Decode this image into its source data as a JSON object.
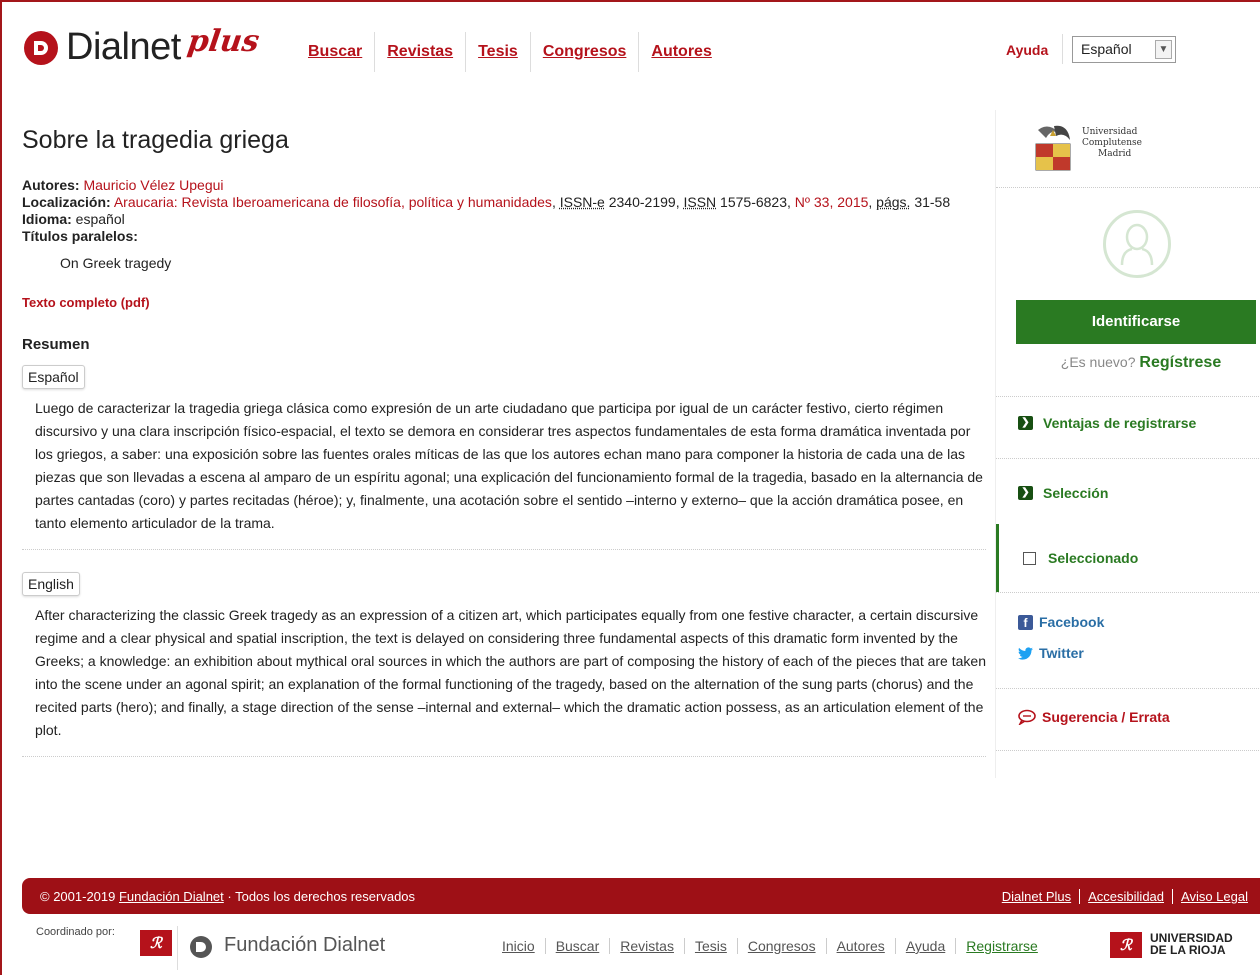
{
  "header": {
    "logo_text": "Dialnet",
    "logo_plus": "plus",
    "nav": [
      "Buscar",
      "Revistas",
      "Tesis",
      "Congresos",
      "Autores"
    ],
    "help": "Ayuda",
    "language": "Español"
  },
  "article": {
    "title": "Sobre la tragedia griega",
    "authors_label": "Autores:",
    "authors": "Mauricio Vélez Upegui",
    "location_label": "Localización:",
    "journal": "Araucaria: Revista Iberoamericana de filosofía, política y humanidades",
    "issn_e_label": "ISSN-e",
    "issn_e": "2340-2199",
    "issn_label": "ISSN",
    "issn": "1575-6823",
    "issue": "Nº 33, 2015",
    "pages_label": "págs.",
    "pages": "31-58",
    "language_label": "Idioma:",
    "language": "español",
    "parallel_titles_label": "Títulos paralelos:",
    "parallel_title": "On Greek tragedy",
    "fulltext": "Texto completo (pdf)",
    "summary_label": "Resumen",
    "abstracts": [
      {
        "lang": "Español",
        "text": "Luego de caracterizar la tragedia griega clásica como expresión de un arte ciudadano que participa por igual de un carácter festivo, cierto régimen discursivo y una clara inscripción físico-espacial, el texto se demora en considerar tres aspectos fundamentales de esta forma dramática inventada por los griegos, a saber: una exposición sobre las fuentes orales míticas de las que los autores echan mano para componer la historia de cada una de las piezas que son llevadas a escena al amparo de un espíritu agonal; una explicación del funcionamiento formal de la tragedia, basado en la alternancia de partes cantadas (coro) y partes recitadas (héroe); y, finalmente, una acotación sobre el sentido –interno y externo– que la acción dramática posee, en tanto elemento articulador de la trama."
      },
      {
        "lang": "English",
        "text": "After characterizing the classic Greek tragedy as an expression of a citizen art, which participates equally from one festive character, a certain discursive regime and a clear physical and spatial inscription, the text is delayed on considering three fundamental aspects of this dramatic form invented by the Greeks; a knowledge: an exhibition about mythical oral sources in which the authors are part of composing the history of each of the pieces that are taken into the scene under an agonal spirit; an explanation of the formal functioning of the tragedy, based on the alternation of the sung parts (chorus) and the recited parts (hero); and finally, a stage direction of the sense –internal and external– which the dramatic action possess, as an articulation element of the plot."
      }
    ]
  },
  "sidebar": {
    "university": [
      "Universidad",
      "Complutense",
      "Madrid"
    ],
    "login": "Identificarse",
    "new_user": "¿Es nuevo?",
    "register": "Regístrese",
    "advantages": "Ventajas de registrarse",
    "selection": "Selección",
    "selected": "Seleccionado",
    "facebook": "Facebook",
    "twitter": "Twitter",
    "suggestion": "Sugerencia / Errata"
  },
  "footer": {
    "copyright_prefix": "© 2001-2019 ",
    "foundation_link": "Fundación Dialnet",
    "copyright_suffix": " · Todos los derechos reservados",
    "links": [
      "Dialnet Plus",
      "Accesibilidad",
      "Aviso Legal"
    ],
    "coordinated_by": "Coordinado por:",
    "foundation_name": "Fundación Dialnet",
    "bottom_links": [
      "Inicio",
      "Buscar",
      "Revistas",
      "Tesis",
      "Congresos",
      "Autores",
      "Ayuda",
      "Registrarse"
    ],
    "university_line1": "UNIVERSIDAD",
    "university_line2": "DE LA RIOJA"
  },
  "colors": {
    "brand_red": "#b5121b",
    "green": "#2a7a22",
    "footer_red": "#9e1016"
  }
}
